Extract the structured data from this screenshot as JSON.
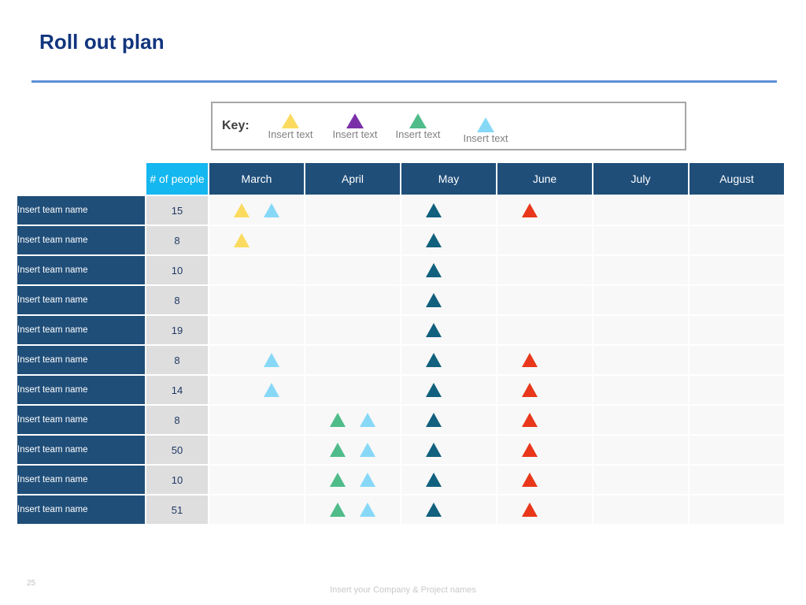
{
  "slide": {
    "title": "Roll out plan",
    "page_number": "25",
    "footer_note": "Insert your Company & Project names",
    "rule_color": "#5B8FD6",
    "title_color": "#12357E"
  },
  "key": {
    "label": "Key:",
    "items": [
      {
        "text": "Insert text",
        "color": "#FADB5F",
        "icon": "triangle-icon"
      },
      {
        "text": "Insert text",
        "color": "#7A2FA8",
        "icon": "triangle-icon"
      },
      {
        "text": "Insert text",
        "color": "#4FBC8A",
        "icon": "triangle-icon"
      },
      {
        "text": "Insert text",
        "color": "#87D8F7",
        "icon": "triangle-icon"
      }
    ]
  },
  "table": {
    "headers": {
      "team": "",
      "people": "# of people",
      "months": [
        "March",
        "April",
        "May",
        "June",
        "July",
        "August"
      ]
    },
    "header_colors": {
      "people_bg": "#14B7EF",
      "month_bg": "#1F4E79",
      "team_bg": "#1F4E79",
      "people_cell_bg": "#DEDEDE"
    },
    "marker_colors": {
      "yellow": "#FADB5F",
      "purple": "#7A2FA8",
      "green": "#4FBC8A",
      "lightblue": "#87D8F7",
      "teal": "#11607E",
      "red": "#E8371A"
    },
    "rows": [
      {
        "team": "Insert team name",
        "people": "15",
        "March": [
          "yellow",
          "lightblue"
        ],
        "April": [
          "",
          ""
        ],
        "May": [
          "teal",
          ""
        ],
        "June": [
          "red",
          ""
        ],
        "July": [
          "",
          ""
        ],
        "August": [
          "",
          ""
        ]
      },
      {
        "team": "Insert team name",
        "people": "8",
        "March": [
          "yellow",
          ""
        ],
        "April": [
          "",
          ""
        ],
        "May": [
          "teal",
          ""
        ],
        "June": [
          "",
          ""
        ],
        "July": [
          "",
          ""
        ],
        "August": [
          "",
          ""
        ]
      },
      {
        "team": "Insert team name",
        "people": "10",
        "March": [
          "",
          ""
        ],
        "April": [
          "",
          ""
        ],
        "May": [
          "teal",
          ""
        ],
        "June": [
          "",
          ""
        ],
        "July": [
          "",
          ""
        ],
        "August": [
          "",
          ""
        ]
      },
      {
        "team": "Insert team name",
        "people": "8",
        "March": [
          "",
          ""
        ],
        "April": [
          "",
          ""
        ],
        "May": [
          "teal",
          ""
        ],
        "June": [
          "",
          ""
        ],
        "July": [
          "",
          ""
        ],
        "August": [
          "",
          ""
        ]
      },
      {
        "team": "Insert team name",
        "people": "19",
        "March": [
          "",
          ""
        ],
        "April": [
          "",
          ""
        ],
        "May": [
          "teal",
          ""
        ],
        "June": [
          "",
          ""
        ],
        "July": [
          "",
          ""
        ],
        "August": [
          "",
          ""
        ]
      },
      {
        "team": "Insert team name",
        "people": "8",
        "March": [
          "",
          "lightblue"
        ],
        "April": [
          "",
          ""
        ],
        "May": [
          "teal",
          ""
        ],
        "June": [
          "red",
          ""
        ],
        "July": [
          "",
          ""
        ],
        "August": [
          "",
          ""
        ]
      },
      {
        "team": "Insert team name",
        "people": "14",
        "March": [
          "",
          "lightblue"
        ],
        "April": [
          "",
          ""
        ],
        "May": [
          "teal",
          ""
        ],
        "June": [
          "red",
          ""
        ],
        "July": [
          "",
          ""
        ],
        "August": [
          "",
          ""
        ]
      },
      {
        "team": "Insert team name",
        "people": "8",
        "March": [
          "",
          ""
        ],
        "April": [
          "green",
          "lightblue"
        ],
        "May": [
          "teal",
          ""
        ],
        "June": [
          "red",
          ""
        ],
        "July": [
          "",
          ""
        ],
        "August": [
          "",
          ""
        ]
      },
      {
        "team": "Insert team name",
        "people": "50",
        "March": [
          "",
          ""
        ],
        "April": [
          "green",
          "lightblue"
        ],
        "May": [
          "teal",
          ""
        ],
        "June": [
          "red",
          ""
        ],
        "July": [
          "",
          ""
        ],
        "August": [
          "",
          ""
        ]
      },
      {
        "team": "Insert team name",
        "people": "10",
        "March": [
          "",
          ""
        ],
        "April": [
          "green",
          "lightblue"
        ],
        "May": [
          "teal",
          ""
        ],
        "June": [
          "red",
          ""
        ],
        "July": [
          "",
          ""
        ],
        "August": [
          "",
          ""
        ]
      },
      {
        "team": "Insert team name",
        "people": "51",
        "March": [
          "",
          ""
        ],
        "April": [
          "green",
          "lightblue"
        ],
        "May": [
          "teal",
          ""
        ],
        "June": [
          "red",
          ""
        ],
        "July": [
          "",
          ""
        ],
        "August": [
          "",
          ""
        ]
      }
    ]
  }
}
